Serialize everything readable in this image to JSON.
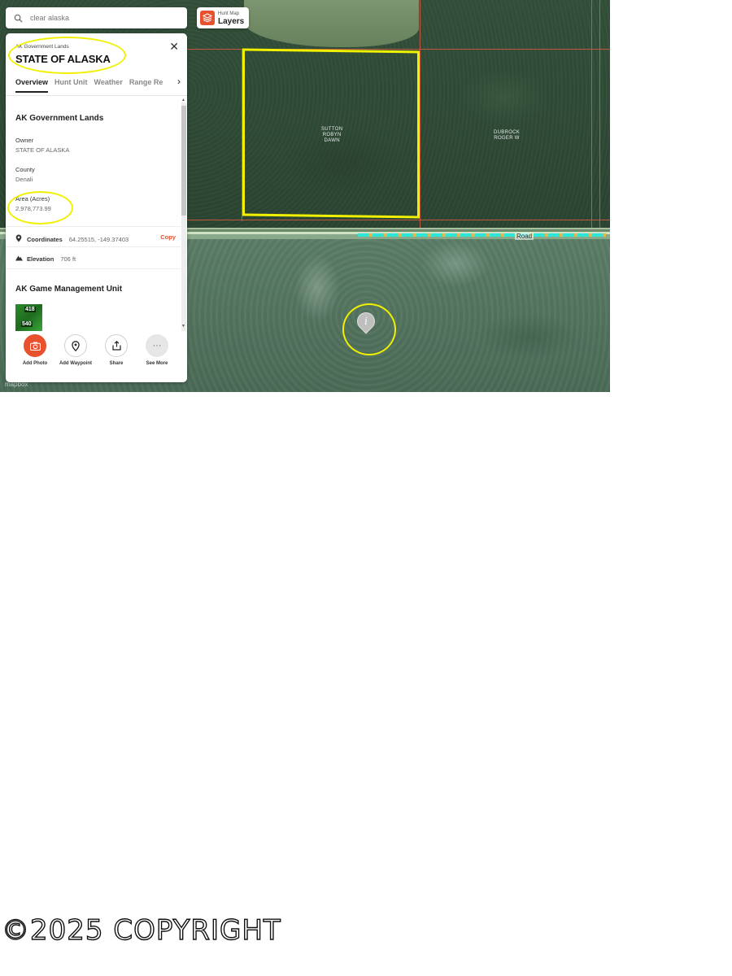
{
  "search": {
    "placeholder": "clear alaska"
  },
  "layers_button": {
    "small_label": "Hunt Map",
    "label": "Layers"
  },
  "panel": {
    "subtitle": "AK Government Lands",
    "title": "STATE OF ALASKA",
    "tabs": [
      {
        "label": "Overview",
        "active": true
      },
      {
        "label": "Hunt Unit",
        "active": false
      },
      {
        "label": "Weather",
        "active": false
      },
      {
        "label": "Range Re",
        "active": false
      }
    ],
    "section1": {
      "heading": "AK Government Lands",
      "owner_label": "Owner",
      "owner_value": "STATE OF ALASKA",
      "county_label": "County",
      "county_value": "Denali",
      "area_label": "Area (Acres)",
      "area_value": "2,978,773.99"
    },
    "coordinates": {
      "label": "Coordinates",
      "value": "64.25515, -149.37403",
      "copy": "Copy"
    },
    "elevation": {
      "label": "Elevation",
      "value": "706 ft"
    },
    "section2": {
      "heading": "AK Game Management Unit",
      "thumb_top": "418",
      "thumb_bottom": "540"
    },
    "actions": [
      {
        "label": "Add Photo",
        "icon": "camera-icon"
      },
      {
        "label": "Add Waypoint",
        "icon": "pin-icon"
      },
      {
        "label": "Share",
        "icon": "share-icon"
      },
      {
        "label": "See More",
        "icon": "more-icon"
      }
    ]
  },
  "map": {
    "parcel_owners": [
      "SUTTON\nROBYN\nDAWN",
      "DUBROCK\nROGER W"
    ],
    "road_label": "Road",
    "attribution": "mapbox",
    "info_marker": "i"
  },
  "colors": {
    "accent": "#e8502e",
    "annotation": "#f0f000",
    "parcel_line": "#c4573f",
    "trail": "#2ee6d8"
  },
  "watermark": "©2025 COPYRIGHT"
}
